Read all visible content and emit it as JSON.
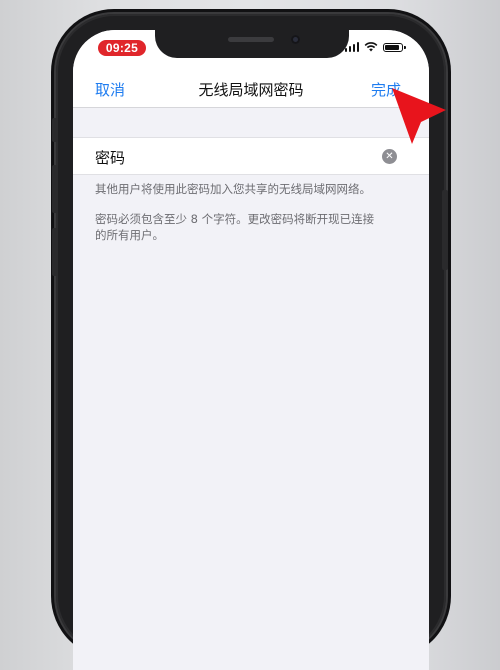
{
  "status_bar": {
    "time": "09:25"
  },
  "nav": {
    "cancel_label": "取消",
    "title": "无线局域网密码",
    "done_label": "完成"
  },
  "password_field": {
    "label": "密码",
    "clear_icon": "clear-x-circle"
  },
  "notes": {
    "share_hint": "其他用户将使用此密码加入您共享的无线局域网网络。",
    "requirement_hint_line1": "密码必须包含至少 8 个字符。更改密码将断开现已连接",
    "requirement_hint_line2": "的所有用户。"
  },
  "colors": {
    "accent": "#1e7cf0",
    "time_pill": "#e0262b",
    "annotation_arrow": "#e8141c"
  }
}
